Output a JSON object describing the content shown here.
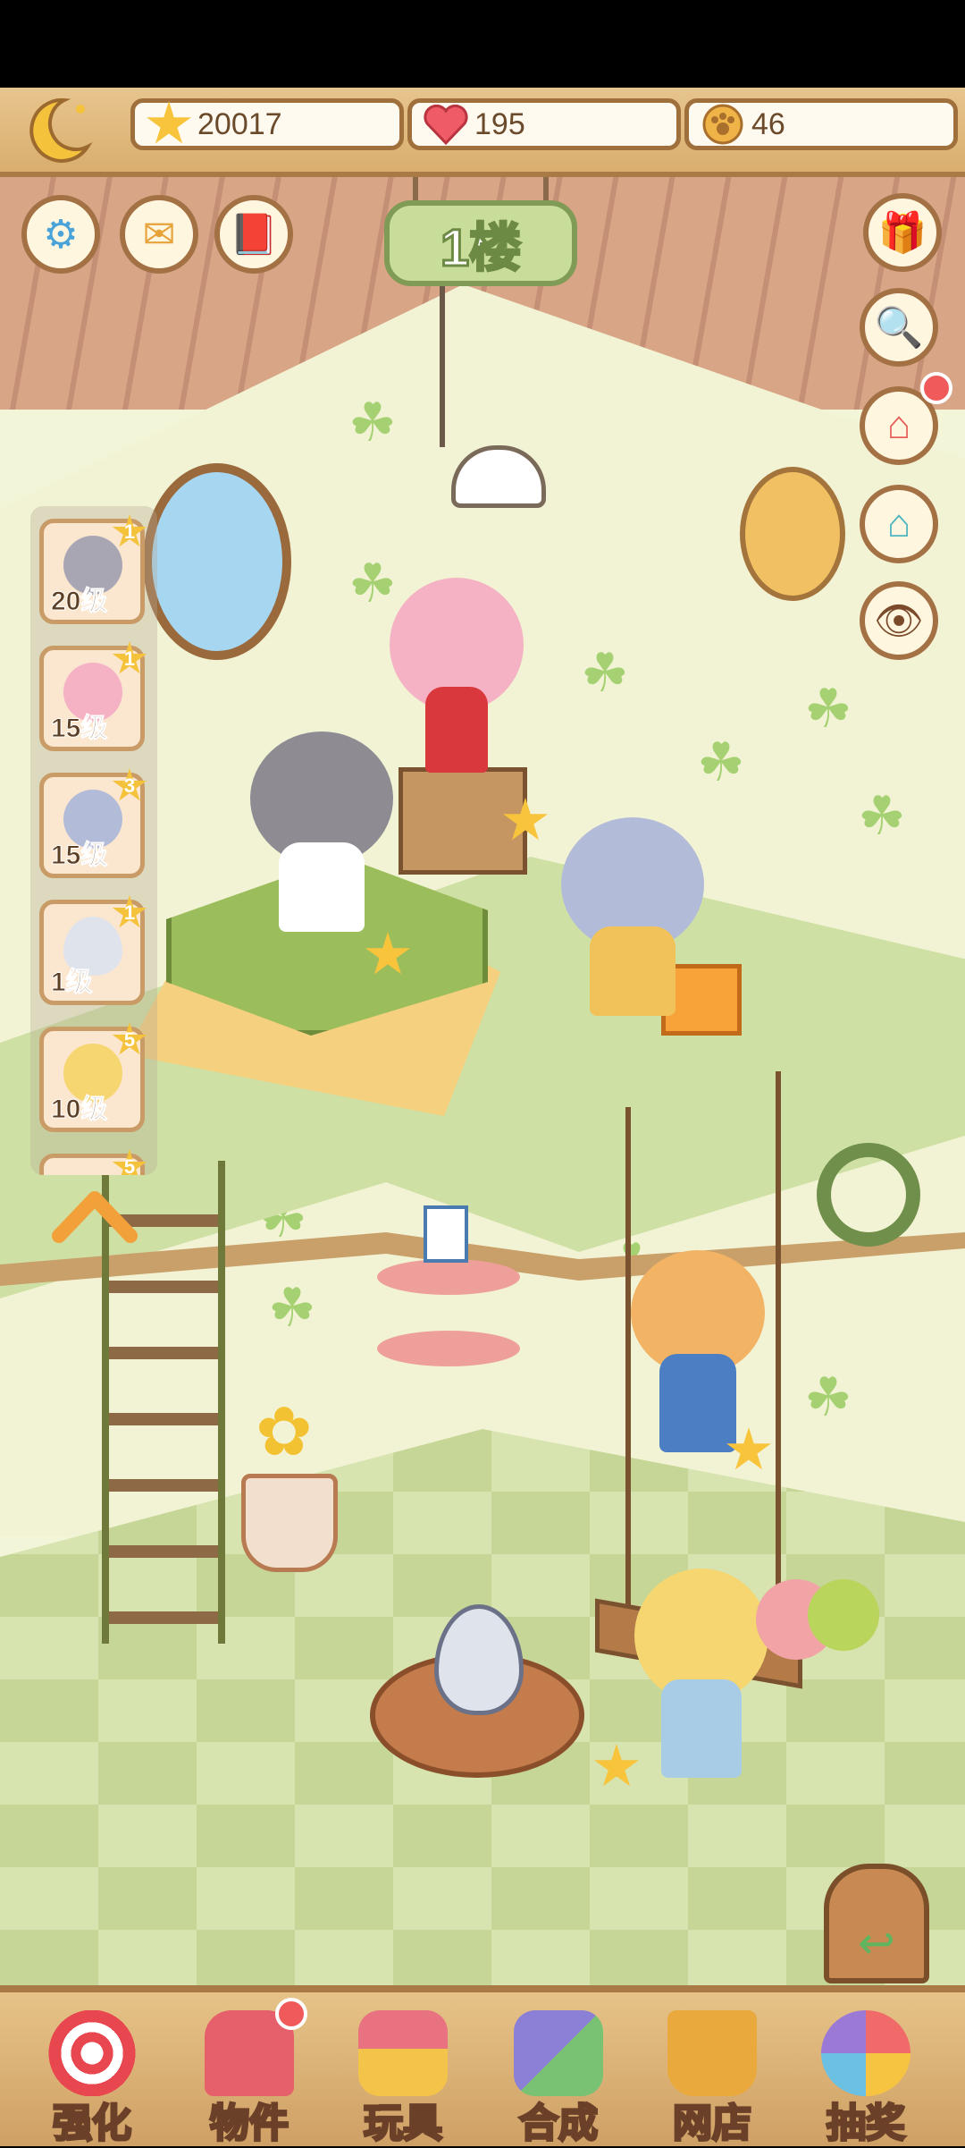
{
  "top_bar": {
    "moon_icon": "moon-icon",
    "resources": [
      {
        "name": "stars",
        "icon": "star-icon",
        "value": "20017"
      },
      {
        "name": "hearts",
        "icon": "heart-icon",
        "value": "195"
      },
      {
        "name": "paw_coins",
        "icon": "paw-coin-icon",
        "value": "46"
      }
    ]
  },
  "room": {
    "floor_sign": "1楼",
    "left_buttons": [
      "gear-icon",
      "mail-icon",
      "book-icon"
    ],
    "right_buttons": [
      "gift-icon",
      "magnifier-icon",
      "home-icon",
      "social-house-icon",
      "eye-icon"
    ],
    "roster": [
      {
        "level": "20级",
        "badge": "1"
      },
      {
        "level": "15级",
        "badge": "1"
      },
      {
        "level": "15级",
        "badge": "3"
      },
      {
        "level": "1级",
        "badge": "1"
      },
      {
        "level": "10级",
        "badge": "5"
      },
      {
        "level": "",
        "badge": "5"
      }
    ]
  },
  "bottom_nav": [
    {
      "label": "强化",
      "icon": "candy-icon"
    },
    {
      "label": "物件",
      "icon": "piano-icon",
      "dot": true
    },
    {
      "label": "玩具",
      "icon": "toy-house-icon"
    },
    {
      "label": "合成",
      "icon": "cards-icon"
    },
    {
      "label": "网店",
      "icon": "basket-icon"
    },
    {
      "label": "抽奖",
      "icon": "wheel-icon"
    }
  ],
  "colors": {
    "wood": "#a97a45",
    "cream": "#fffaf0",
    "clover": "#a6d173"
  }
}
